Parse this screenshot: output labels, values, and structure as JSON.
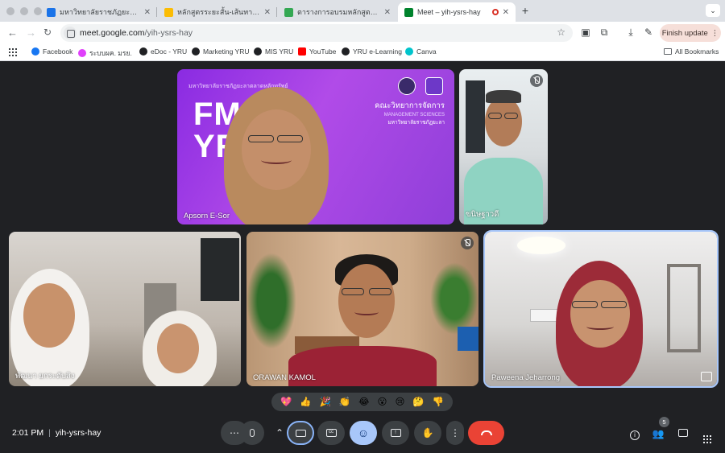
{
  "browser": {
    "tabs": [
      {
        "title": "มหาวิทยาลัยราชภัฏยะลา - Caler",
        "favicon_color": "#1a73e8"
      },
      {
        "title": "หลักสูตรระยะสั้น-เส้นทางนักการตลาด",
        "favicon_color": "#fbbc04"
      },
      {
        "title": "ตารางการอบรมหลักสูตรระยะสั้น",
        "favicon_color": "#34a853"
      },
      {
        "title": "Meet – yih-ysrs-hay",
        "favicon_color": "#00832d"
      }
    ],
    "new_tab": "+",
    "url_host": "meet.google.com",
    "url_path": "/yih-ysrs-hay",
    "finish_update": "Finish update",
    "bookmarks": [
      {
        "label": "Facebook",
        "color": "#1877f2"
      },
      {
        "label": "ระบบผค. มรย.",
        "color": "#e040fb"
      },
      {
        "label": "eDoc - YRU",
        "color": "#202124"
      },
      {
        "label": "Marketing YRU",
        "color": "#202124"
      },
      {
        "label": "MIS YRU",
        "color": "#202124"
      },
      {
        "label": "YouTube",
        "color": "#ff0000"
      },
      {
        "label": "YRU e-Learning",
        "color": "#202124"
      },
      {
        "label": "Canva",
        "color": "#00c4cc"
      }
    ],
    "all_bookmarks": "All Bookmarks"
  },
  "meet": {
    "participants": [
      {
        "name": "Apsorn E-Sor"
      },
      {
        "name": "ขนิษฐาวดี"
      },
      {
        "name": "พัฒนา ยกระดับสิง"
      },
      {
        "name": "ORAWAN KAMOL"
      },
      {
        "name": "Paweena Jeharrong"
      }
    ],
    "banner": {
      "line1": "มหาวิทยาลัยราชภัฏยะลาตลาดหลักทรัพย์",
      "big": "FM\nYR",
      "faculty_th": "คณะวิทยาการจัดการ",
      "faculty_en": "MANAGEMENT SCIENCES",
      "university_th": "มหาวิทยาลัยราชภัฏยะลา"
    },
    "reactions": [
      "💖",
      "👍",
      "🎉",
      "👏",
      "😂",
      "😮",
      "😢",
      "🤔",
      "👎"
    ],
    "time": "2:01 PM",
    "meeting_code": "yih-ysrs-hay",
    "people_count": "5"
  }
}
